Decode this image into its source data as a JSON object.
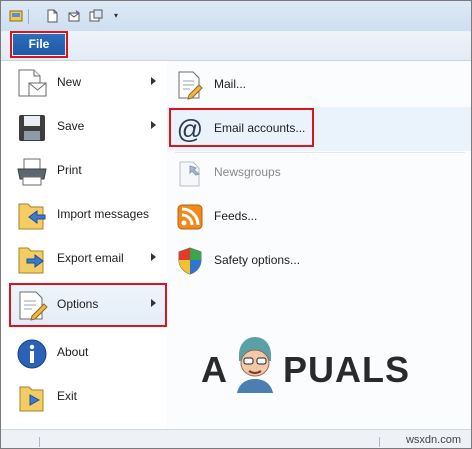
{
  "file_tab": {
    "label": "File"
  },
  "left_menu": {
    "items": [
      {
        "label": "New",
        "icon": "new-document-icon",
        "has_submenu": true
      },
      {
        "label": "Save",
        "icon": "save-disk-icon",
        "has_submenu": true
      },
      {
        "label": "Print",
        "icon": "printer-icon",
        "has_submenu": false
      },
      {
        "label": "Import messages",
        "icon": "import-folder-icon",
        "has_submenu": false
      },
      {
        "label": "Export email",
        "icon": "export-folder-icon",
        "has_submenu": true
      },
      {
        "label": "Options",
        "icon": "options-document-icon",
        "has_submenu": true,
        "selected": true
      },
      {
        "label": "About",
        "icon": "info-icon",
        "has_submenu": false
      },
      {
        "label": "Exit",
        "icon": "exit-folder-icon",
        "has_submenu": false
      }
    ]
  },
  "right_menu": {
    "items": [
      {
        "label": "Mail...",
        "icon": "mail-options-icon",
        "enabled": true
      },
      {
        "label": "Email accounts...",
        "icon": "at-sign-icon",
        "enabled": true,
        "highlighted": true
      },
      {
        "label": "Newsgroups",
        "icon": "newsgroups-icon",
        "enabled": false
      },
      {
        "label": "Feeds...",
        "icon": "rss-feed-icon",
        "enabled": true
      },
      {
        "label": "Safety options...",
        "icon": "safety-shield-icon",
        "enabled": true
      }
    ]
  },
  "watermark": {
    "brand_left": "A",
    "brand_right": "PUALS"
  },
  "corner_watermark": "wsxdn.com",
  "colors": {
    "file_tab_blue": "#1e5aa6",
    "highlight_red": "#d8161f",
    "ribbon_light": "#e3ebf5",
    "selection_blue": "#eaf2fb"
  }
}
